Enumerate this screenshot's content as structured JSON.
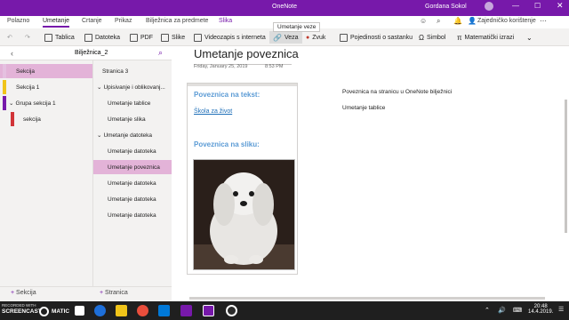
{
  "app": {
    "title": "OneNote",
    "user": "Gordana Sokol"
  },
  "ribbon": {
    "tabs": [
      "Polazno",
      "Umetanje",
      "Crtanje",
      "Prikaz",
      "Bilježnica za predmete",
      "Slika"
    ],
    "active_tab": "Umetanje",
    "share_label": "Zajedničko korištenje"
  },
  "toolbar": {
    "items": [
      "Tablica",
      "Datoteka",
      "PDF",
      "Slike",
      "Videozapis s interneta",
      "Veza",
      "Zvuk",
      "Pojedinosti o sastanku",
      "Simbol",
      "Matematički izrazi"
    ],
    "tooltip": "Umetanje veze"
  },
  "notebook": {
    "name": "Bilježnica_2"
  },
  "sections": [
    "Sekcija",
    "Sekcija 1",
    "Grupa sekcija 1",
    "sekcija"
  ],
  "pages": [
    "Stranica 3",
    "Upisivanje i oblikovanj...",
    "Umetanje tablice",
    "Umetanje slika",
    "Umetanje datoteka",
    "Umetanje datoteka",
    "Umetanje poveznica",
    "Umetanje datoteka",
    "Umetanje datoteka",
    "Umetanje datoteka"
  ],
  "bottom": {
    "add_section": "Sekcija",
    "add_page": "Stranica"
  },
  "page": {
    "title": "Umetanje poveznica",
    "date": "Friday, January 25, 2019",
    "time": "8:53 PM",
    "heading_text_link": "Poveznica na tekst:",
    "link_text": "Škola za život",
    "heading_image_link": "Poveznica na sliku:",
    "right_line1": "Poveznica na stranicu u OneNote bilježnici",
    "right_line2": "Umetanje tablice"
  },
  "taskbar": {
    "recorder_top": "RECORDED WITH",
    "recorder_brand": "SCREENCAST",
    "recorder_suffix": "MATIC",
    "time": "20:48",
    "date": "14.4.2019."
  },
  "colors": {
    "brand": "#7719aa",
    "section_pink": "#e3b3d8",
    "link_blue": "#1e6fb8"
  }
}
